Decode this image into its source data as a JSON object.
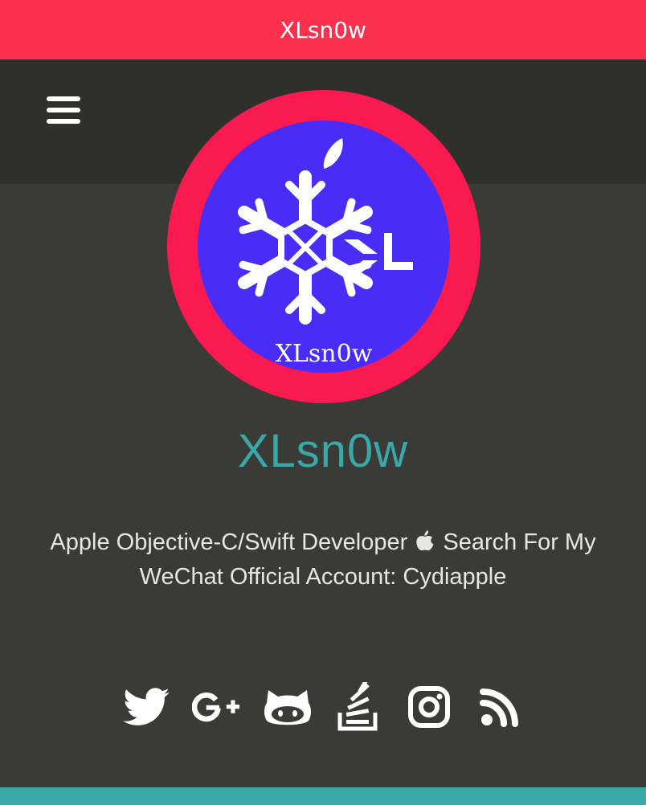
{
  "header": {
    "title": "XLsn0w",
    "background": "#fb304d"
  },
  "navigation": {
    "menu_icon": "hamburger-menu-icon"
  },
  "profile": {
    "avatar_text": "XLsn0w",
    "name": "XLsn0w",
    "bio_part1": "Apple Objective-C/Swift Developer",
    "bio_part2": "Search For My WeChat Official Account: Cydiapple",
    "name_color": "#3aa7a8",
    "avatar_ring_color": "#fb1a50",
    "avatar_fill_color": "#4a2cf7"
  },
  "social_links": [
    {
      "icon": "twitter-icon"
    },
    {
      "icon": "google-plus-icon"
    },
    {
      "icon": "github-icon"
    },
    {
      "icon": "stack-overflow-icon"
    },
    {
      "icon": "instagram-icon"
    },
    {
      "icon": "rss-icon"
    }
  ],
  "colors": {
    "page_background": "#3a3a36",
    "nav_band": "#2f2f2b",
    "bottom_bar": "#3aa7a8"
  }
}
